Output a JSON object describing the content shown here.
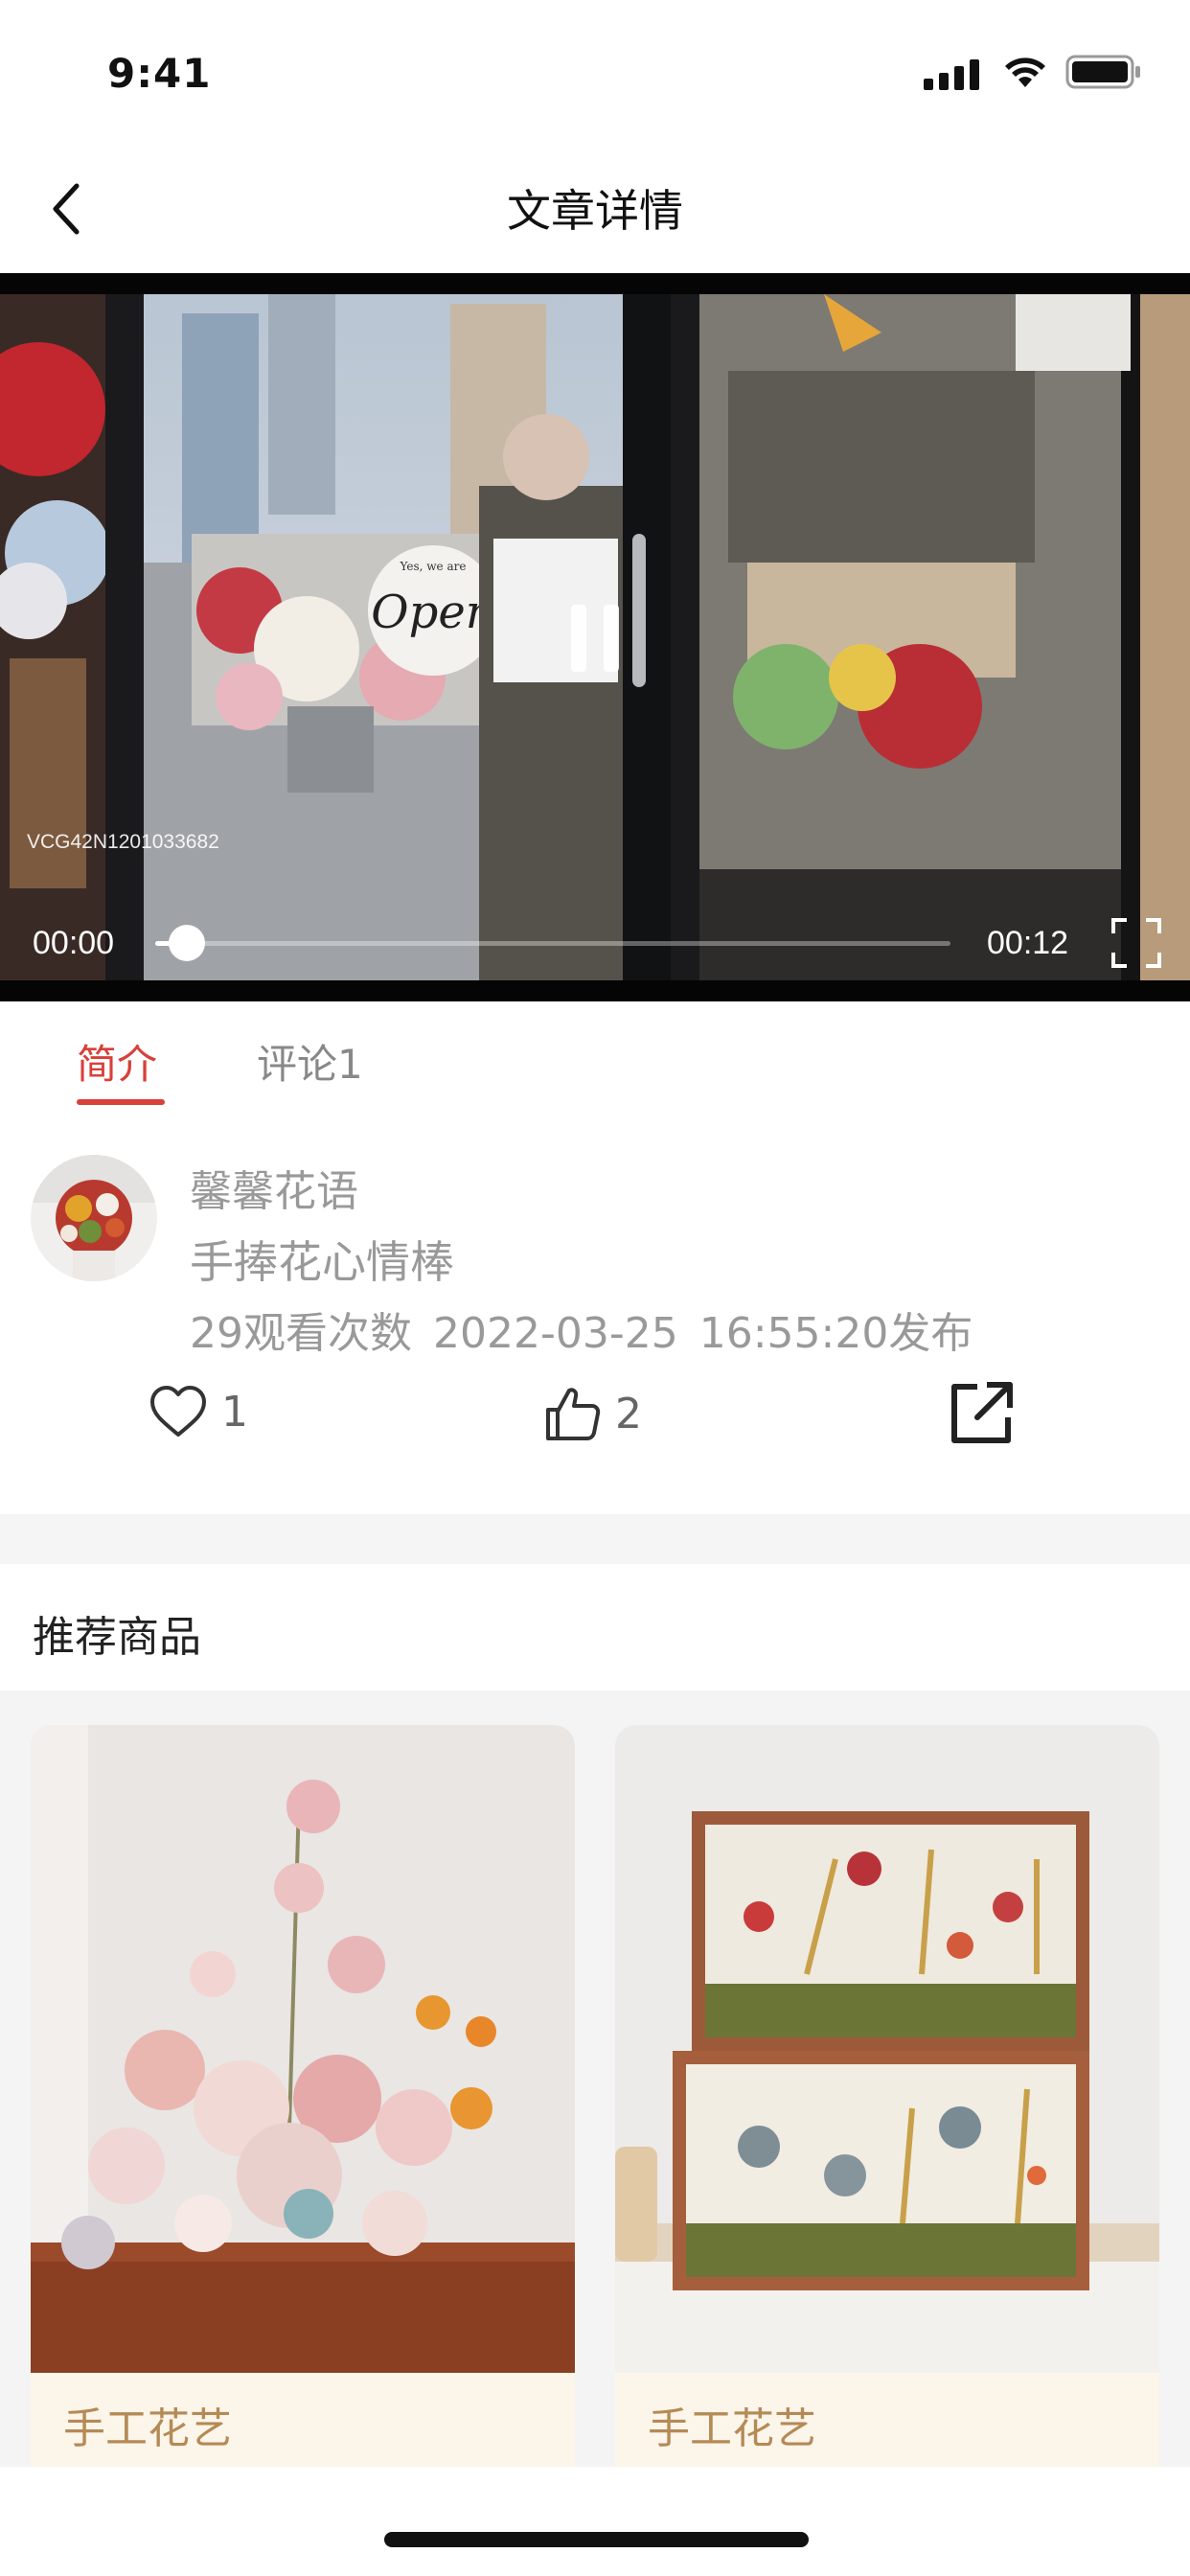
{
  "status_bar": {
    "time": "9:41"
  },
  "nav": {
    "title": "文章详情"
  },
  "video": {
    "watermark": "VCG42N1201033682",
    "sign_text": "Open",
    "sign_small": "Yes, we are",
    "current_time": "00:00",
    "total_time": "00:12",
    "progress_fraction": 0.04
  },
  "tabs": [
    {
      "label": "简介",
      "active": true
    },
    {
      "label": "评论1",
      "active": false
    }
  ],
  "article": {
    "author": "馨馨花语",
    "title": "手捧花心情棒",
    "views": "29观看次数",
    "date": "2022-03-25",
    "time": "16:55:20发布",
    "favorite_count": "1",
    "like_count": "2"
  },
  "recommend": {
    "title": "推荐商品",
    "items": [
      {
        "label": "手工花艺"
      },
      {
        "label": "手工花艺"
      }
    ]
  },
  "colors": {
    "accent": "#d8403a",
    "card_label_bg": "#fbf5ea",
    "card_label_text": "#b48a55"
  },
  "icons": [
    "back-chevron-icon",
    "pause-icon",
    "fullscreen-icon",
    "heart-icon",
    "thumbs-up-icon",
    "share-icon",
    "signal-icon",
    "wifi-icon",
    "battery-icon"
  ]
}
